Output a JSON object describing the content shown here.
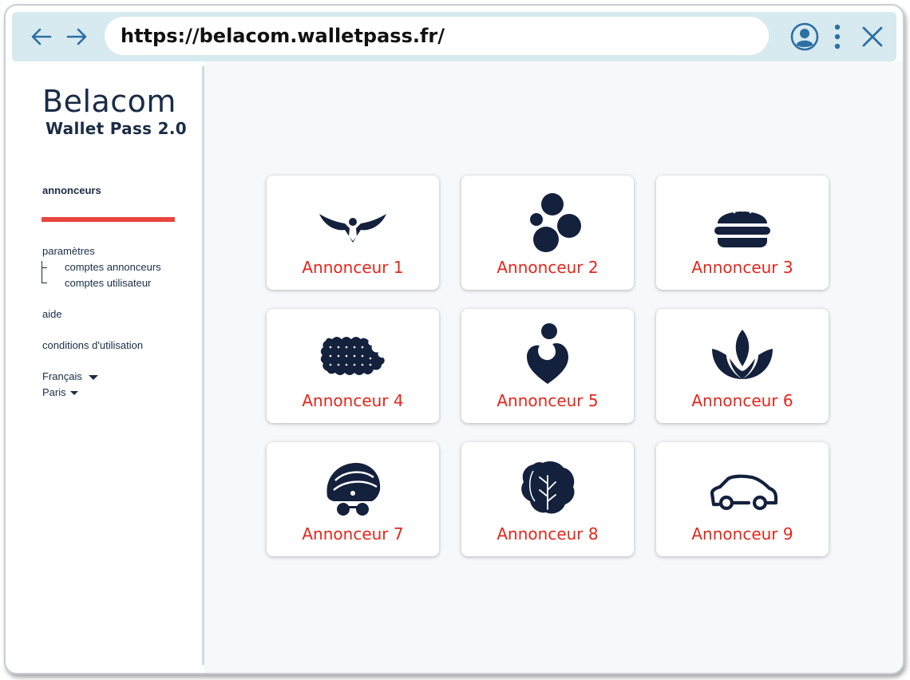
{
  "browser": {
    "url": "https://belacom.walletpass.fr/",
    "back_icon": "arrow-left-icon",
    "forward_icon": "arrow-right-icon",
    "account_icon": "user-circle-icon",
    "menu_icon": "more-vertical-icon",
    "close_icon": "close-icon"
  },
  "brand": {
    "name": "Belacom",
    "subtitle": "Wallet Pass 2.0"
  },
  "sidebar": {
    "active_item": "annonceurs",
    "settings": "paramètres",
    "sub_items": [
      "comptes annonceurs",
      "comptes utilisateur"
    ],
    "help": "aide",
    "terms": "conditions d'utilisation",
    "language": "Français",
    "city": "Paris"
  },
  "advertisers": [
    {
      "label": "Annonceur 1",
      "icon": "eagle-icon"
    },
    {
      "label": "Annonceur 2",
      "icon": "bubbles-icon"
    },
    {
      "label": "Annonceur 3",
      "icon": "burger-icon"
    },
    {
      "label": "Annonceur 4",
      "icon": "biscuit-icon"
    },
    {
      "label": "Annonceur 5",
      "icon": "heart-person-icon"
    },
    {
      "label": "Annonceur 6",
      "icon": "lotus-icon"
    },
    {
      "label": "Annonceur 7",
      "icon": "turban-icon"
    },
    {
      "label": "Annonceur 8",
      "icon": "lettuce-icon"
    },
    {
      "label": "Annonceur 9",
      "icon": "car-icon"
    }
  ],
  "colors": {
    "accent": "#e8453c",
    "label": "#e5261c",
    "icon": "#14213d",
    "browser_bar": "#d7eaf0",
    "content_bg": "#f6f8fa"
  }
}
